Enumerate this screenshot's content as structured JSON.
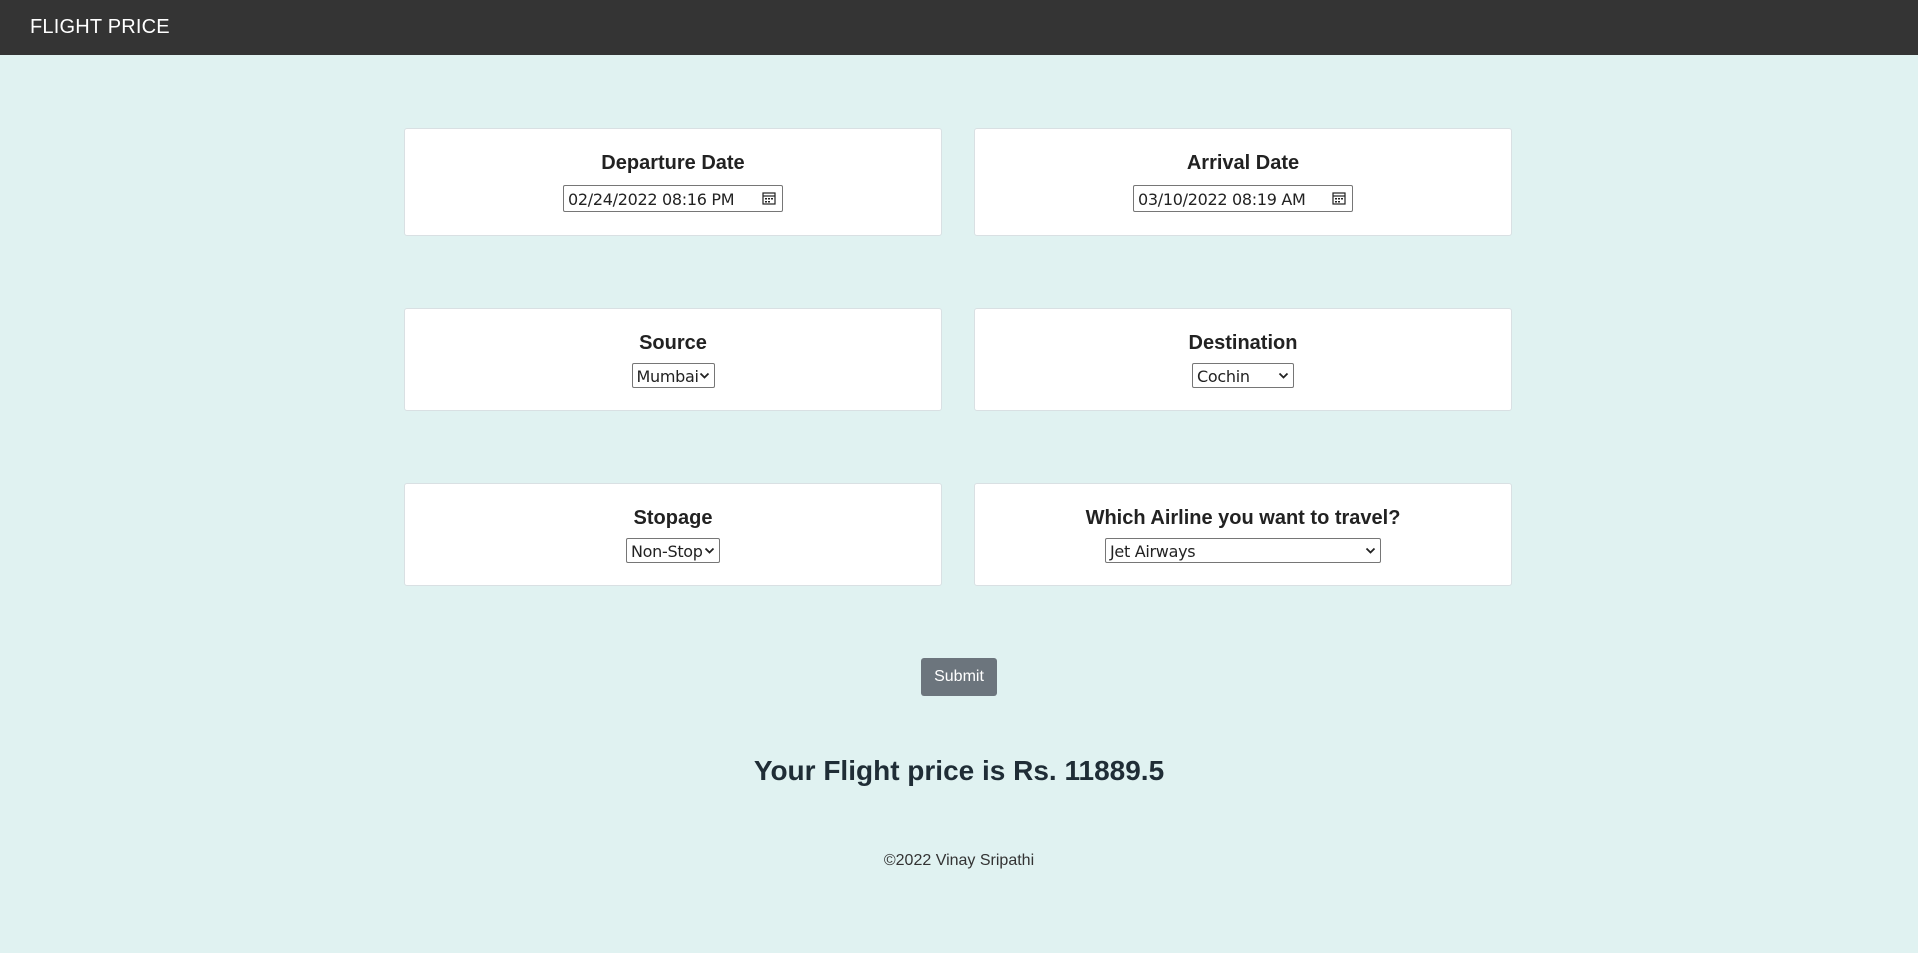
{
  "navbar": {
    "brand": "FLIGHT PRICE"
  },
  "form": {
    "departure": {
      "label": "Departure Date",
      "value": "02/24/2022 08:16  PM"
    },
    "arrival": {
      "label": "Arrival Date",
      "value": "03/10/2022 08:19  AM"
    },
    "source": {
      "label": "Source",
      "selected": "Mumbai"
    },
    "destination": {
      "label": "Destination",
      "selected": "Cochin"
    },
    "stopage": {
      "label": "Stopage",
      "selected": "Non-Stop"
    },
    "airline": {
      "label": "Which Airline you want to travel?",
      "selected": "Jet Airways"
    },
    "submit_label": "Submit"
  },
  "result": {
    "text": "Your Flight price is Rs. 11889.5"
  },
  "footer": {
    "text": "©2022 Vinay Sripathi"
  },
  "colors": {
    "navbar_bg": "#343434",
    "page_bg": "#e0f2f1",
    "button_bg": "#6c757d"
  }
}
